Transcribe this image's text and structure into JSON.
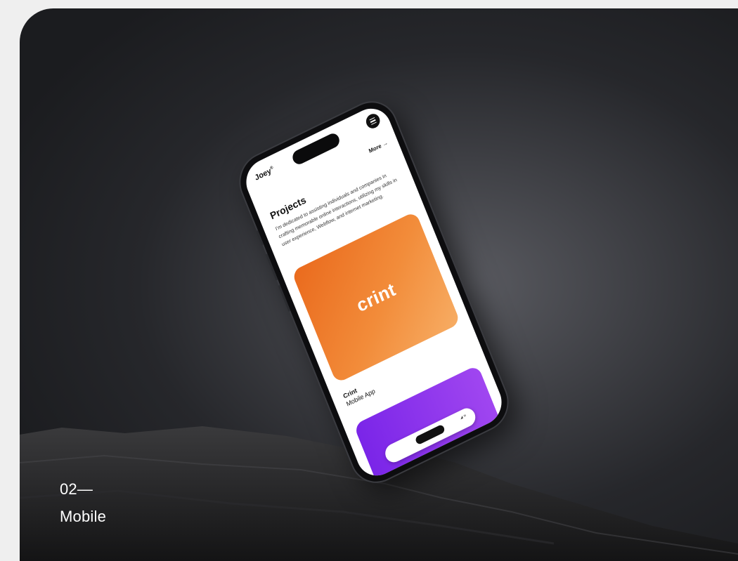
{
  "caption": {
    "number": "02—",
    "label": "Mobile"
  },
  "phone": {
    "brand": "Joey",
    "brand_mark": "®",
    "more_link": "More →",
    "section_title": "Projects",
    "section_description": "I'm dedicated to assisting individuals and companies in crafting memorable online interactions, utilizing my skills in user experience, Webflow, and internet marketing.",
    "project": {
      "logo_text": "crint",
      "name": "Crint",
      "type": "Mobile App"
    },
    "colors": {
      "orange_card": "#ef7d2a",
      "purple_card": "#8b35ec"
    }
  }
}
